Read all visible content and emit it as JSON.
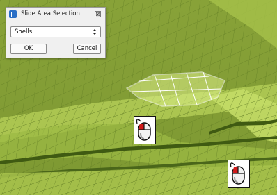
{
  "dialog": {
    "title": "Slide Area Selection",
    "app_icon": "window-app-icon",
    "close_glyph": "⊠",
    "select": {
      "value": "Shells",
      "icon": "updown-arrows-icon"
    },
    "ok_label": "OK",
    "cancel_label": "Cancel"
  },
  "viewport": {
    "surface_colors": {
      "light": "#c2da62",
      "mid": "#94b040",
      "dark": "#6f8a2e",
      "edge": "#4f6a1e"
    },
    "selection_outline_color": "#ffffff",
    "selection_fill_color": "#dcef88"
  },
  "mouse_hints": [
    {
      "icon": "mouse-left-click-icon",
      "button_color": "#d11a1a"
    },
    {
      "icon": "mouse-left-click-icon",
      "button_color": "#d11a1a"
    }
  ]
}
